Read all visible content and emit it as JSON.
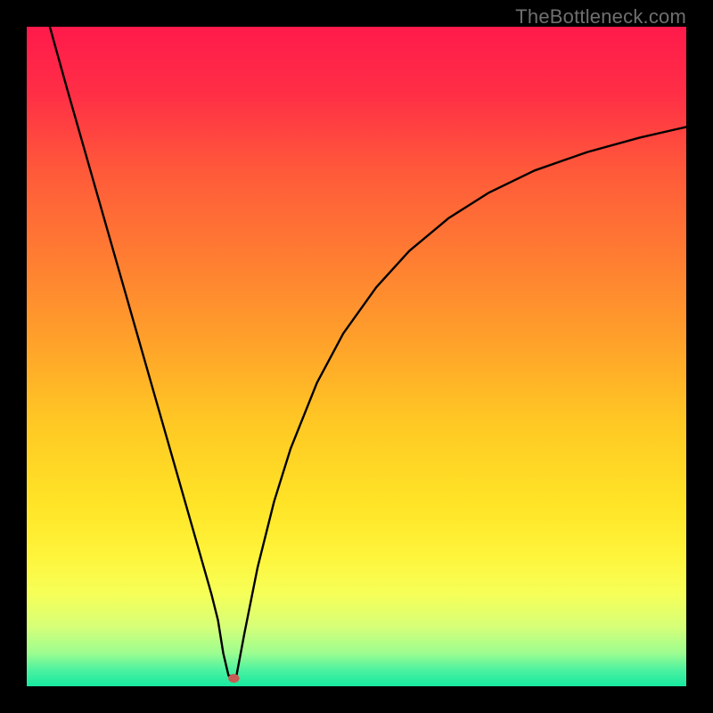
{
  "watermark": "TheBottleneck.com",
  "colors": {
    "frame": "#000000",
    "gradient_stops": [
      {
        "offset": 0.0,
        "color": "#ff1a4b"
      },
      {
        "offset": 0.1,
        "color": "#ff2e46"
      },
      {
        "offset": 0.22,
        "color": "#ff5a3a"
      },
      {
        "offset": 0.35,
        "color": "#ff7d32"
      },
      {
        "offset": 0.48,
        "color": "#ffa22a"
      },
      {
        "offset": 0.6,
        "color": "#ffc824"
      },
      {
        "offset": 0.72,
        "color": "#ffe326"
      },
      {
        "offset": 0.8,
        "color": "#fff43a"
      },
      {
        "offset": 0.86,
        "color": "#f6ff58"
      },
      {
        "offset": 0.91,
        "color": "#d6ff78"
      },
      {
        "offset": 0.95,
        "color": "#9cfd90"
      },
      {
        "offset": 0.975,
        "color": "#4df2a0"
      },
      {
        "offset": 1.0,
        "color": "#17e9a0"
      }
    ],
    "curve": "#000000",
    "marker": "#c85a55"
  },
  "chart_data": {
    "type": "line",
    "title": "",
    "xlabel": "",
    "ylabel": "",
    "xlim": [
      0,
      100
    ],
    "ylim": [
      0,
      100
    ],
    "grid": false,
    "legend": false,
    "series": [
      {
        "name": "left-branch",
        "x": [
          3.5,
          6,
          10,
          14,
          18,
          22,
          26,
          28,
          29,
          29.8,
          30.6
        ],
        "y": [
          100,
          91,
          77,
          63,
          49,
          35,
          21,
          14,
          10,
          5,
          1.6
        ]
      },
      {
        "name": "flat-minimum",
        "x": [
          30.6,
          31.8
        ],
        "y": [
          1.6,
          1.6
        ]
      },
      {
        "name": "right-branch",
        "x": [
          31.8,
          33,
          35,
          37.5,
          40,
          44,
          48,
          53,
          58,
          64,
          70,
          77,
          85,
          93,
          100
        ],
        "y": [
          1.6,
          8,
          18,
          28,
          36,
          46,
          53.5,
          60.5,
          66,
          71,
          74.8,
          78.2,
          81,
          83.2,
          84.8
        ]
      }
    ],
    "marker": {
      "x": 31.4,
      "y": 1.2
    },
    "annotations": []
  }
}
